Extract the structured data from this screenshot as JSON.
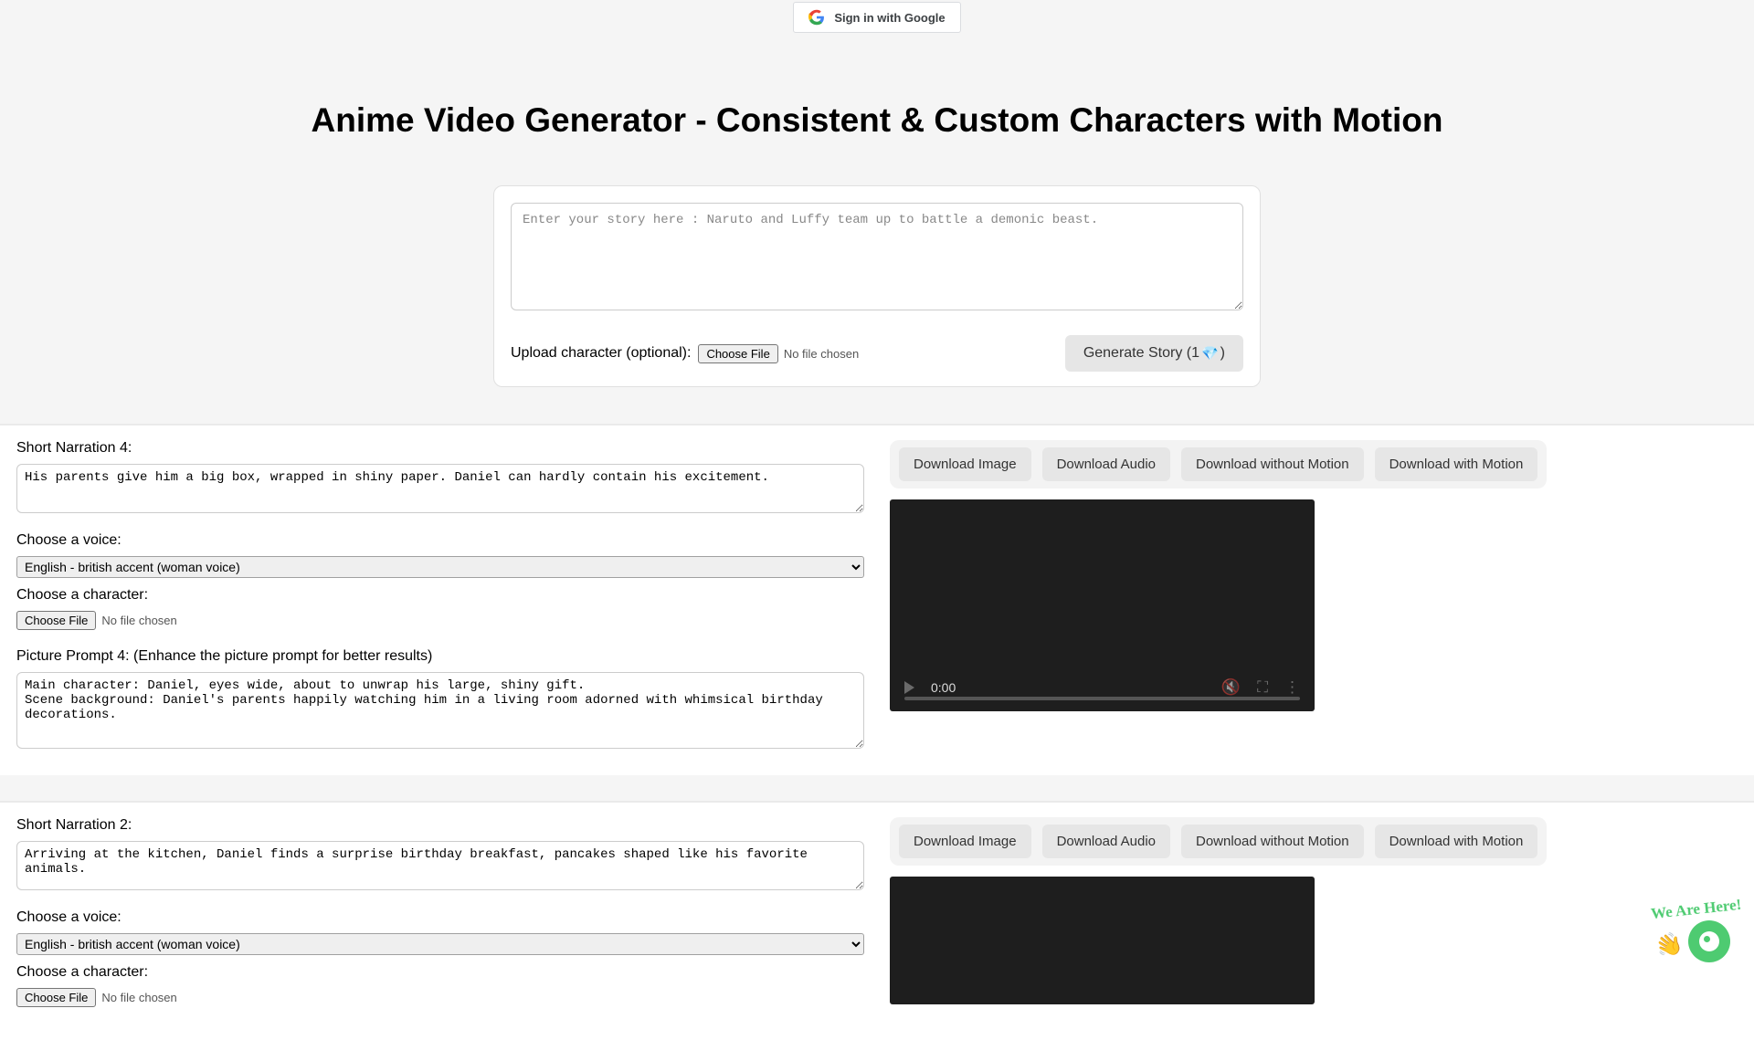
{
  "header": {
    "signin_label": "Sign in with Google"
  },
  "title": "Anime Video Generator - Consistent & Custom Characters with Motion",
  "story_form": {
    "placeholder": "Enter your story here : Naruto and Luffy team up to battle a demonic beast.",
    "upload_label": "Upload character (optional):",
    "choose_file": "Choose File",
    "no_file": "No file chosen",
    "generate_label_prefix": "Generate Story (1 ",
    "generate_label_suffix": ")",
    "gem": "💎"
  },
  "common": {
    "voice_label": "Choose a voice:",
    "voice_value": "English - british accent (woman voice)",
    "char_label": "Choose a character:",
    "choose_file": "Choose File",
    "no_file": "No file chosen",
    "dl_image": "Download Image",
    "dl_audio": "Download Audio",
    "dl_no_motion": "Download without Motion",
    "dl_motion": "Download with Motion",
    "video_time": "0:00"
  },
  "sections": [
    {
      "narration_label": "Short Narration 4:",
      "narration_value": "His parents give him a big box, wrapped in shiny paper. Daniel can hardly contain his excitement.",
      "picture_label": "Picture Prompt 4: (Enhance the picture prompt for better results)",
      "picture_value": "Main character: Daniel, eyes wide, about to unwrap his large, shiny gift.\nScene background: Daniel's parents happily watching him in a living room adorned with whimsical birthday decorations."
    },
    {
      "narration_label": "Short Narration 2:",
      "narration_value": "Arriving at the kitchen, Daniel finds a surprise birthday breakfast, pancakes shaped like his favorite animals.",
      "picture_label": "",
      "picture_value": ""
    }
  ],
  "chat": {
    "tag": "We Are Here!",
    "wave": "👋"
  }
}
